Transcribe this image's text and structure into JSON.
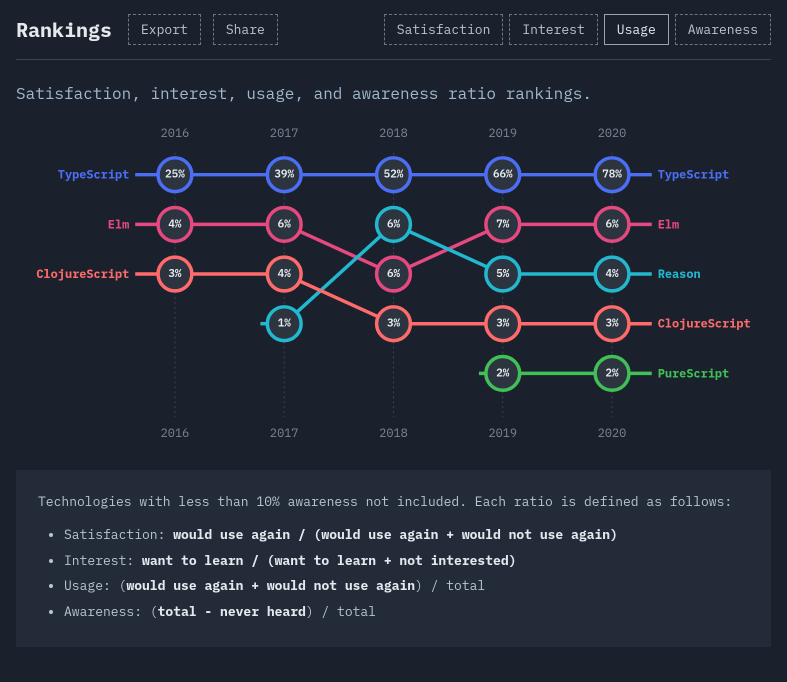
{
  "header": {
    "title": "Rankings",
    "export_label": "Export",
    "share_label": "Share"
  },
  "tabs": [
    {
      "label": "Satisfaction",
      "active": false
    },
    {
      "label": "Interest",
      "active": false
    },
    {
      "label": "Usage",
      "active": true
    },
    {
      "label": "Awareness",
      "active": false
    }
  ],
  "subtitle": "Satisfaction, interest, usage, and awareness ratio rankings.",
  "chart_data": {
    "type": "line",
    "metric": "Usage",
    "categories": [
      "2016",
      "2017",
      "2018",
      "2019",
      "2020"
    ],
    "series": [
      {
        "name": "TypeScript",
        "color": "#4c6ef5",
        "rank": [
          1,
          1,
          1,
          1,
          1
        ],
        "values": [
          "25%",
          "39%",
          "52%",
          "66%",
          "78%"
        ],
        "left_label": "TypeScript",
        "right_label": "TypeScript"
      },
      {
        "name": "Elm",
        "color": "#e64980",
        "rank": [
          2,
          2,
          3,
          2,
          2
        ],
        "values": [
          "4%",
          "6%",
          "6%",
          "7%",
          "6%"
        ],
        "left_label": "Elm",
        "right_label": "Elm"
      },
      {
        "name": "Reason",
        "color": "#22b8cf",
        "rank": [
          null,
          4,
          2,
          3,
          3
        ],
        "values": [
          null,
          "1%",
          "6%",
          "5%",
          "4%"
        ],
        "left_label": null,
        "right_label": "Reason"
      },
      {
        "name": "ClojureScript",
        "color": "#ff6b6b",
        "rank": [
          3,
          3,
          4,
          4,
          4
        ],
        "values": [
          "3%",
          "4%",
          "3%",
          "3%",
          "3%"
        ],
        "left_label": "ClojureScript",
        "right_label": "ClojureScript"
      },
      {
        "name": "PureScript",
        "color": "#40c057",
        "rank": [
          null,
          null,
          null,
          5,
          5
        ],
        "values": [
          null,
          null,
          null,
          "2%",
          "2%"
        ],
        "left_label": null,
        "right_label": "PureScript"
      }
    ]
  },
  "notes": {
    "intro": "Technologies with less than 10% awareness not included. Each ratio is defined as follows:",
    "items": [
      {
        "label": "Satisfaction",
        "def_pre": "",
        "def_bold": "would use again / (would use again + would not use again)",
        "def_post": ""
      },
      {
        "label": "Interest",
        "def_pre": "",
        "def_bold": "want to learn / (want to learn + not interested)",
        "def_post": ""
      },
      {
        "label": "Usage",
        "def_pre": "(",
        "def_bold": "would use again + would not use again",
        "def_post": ") / total"
      },
      {
        "label": "Awareness",
        "def_pre": "(",
        "def_bold": "total - never heard",
        "def_post": ") / total"
      }
    ]
  }
}
